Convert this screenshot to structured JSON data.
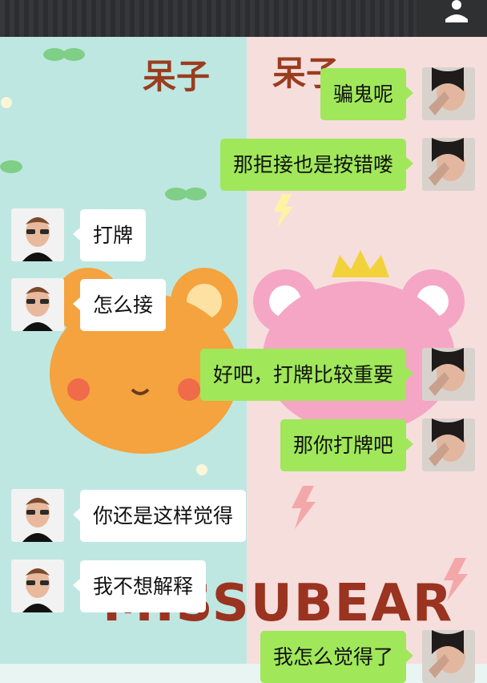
{
  "wallpaper": {
    "label_left": "呆子",
    "label_right": "呆子",
    "brand": "MISSUBEAR"
  },
  "messages": [
    {
      "side": "out",
      "text": "骗鬼呢"
    },
    {
      "side": "out",
      "text": "那拒接也是按错喽"
    },
    {
      "side": "in",
      "text": "打牌"
    },
    {
      "side": "in",
      "text": "怎么接"
    },
    {
      "side": "out",
      "text": "好吧，打牌比较重要"
    },
    {
      "side": "out",
      "text": "那你打牌吧"
    },
    {
      "side": "in",
      "text": "你还是这样觉得"
    },
    {
      "side": "in",
      "text": "我不想解释"
    },
    {
      "side": "out",
      "text": "我怎么觉得了"
    }
  ],
  "colors": {
    "outgoing_bubble": "#a0e75a",
    "incoming_bubble": "#ffffff",
    "top_bar": "#2f3032"
  },
  "icons": {
    "top_right": "person-icon",
    "incoming_avatar": "avatar-man-sunglasses",
    "outgoing_avatar": "avatar-woman-selfie"
  }
}
